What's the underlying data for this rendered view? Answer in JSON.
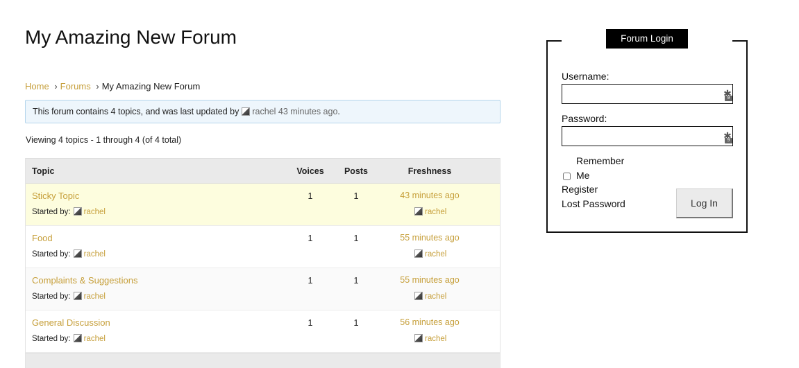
{
  "forum": {
    "title": "My Amazing New Forum",
    "breadcrumb": {
      "home": "Home",
      "forums": "Forums",
      "current": "My Amazing New Forum",
      "separator": "›"
    },
    "notice": {
      "text": "This forum contains 4 topics, and was last updated by",
      "user": "rachel",
      "ago": "43 minutes ago",
      "end": "."
    },
    "count_text": "Viewing 4 topics - 1 through 4 (of 4 total)",
    "columns": {
      "topic": "Topic",
      "voices": "Voices",
      "posts": "Posts",
      "freshness": "Freshness"
    },
    "started_label": "Started by:",
    "topics": [
      {
        "title": "Sticky Topic",
        "author": "rachel",
        "voices": "1",
        "posts": "1",
        "freshness": "43 minutes ago",
        "last_user": "rachel"
      },
      {
        "title": "Food",
        "author": "rachel",
        "voices": "1",
        "posts": "1",
        "freshness": "55 minutes ago",
        "last_user": "rachel"
      },
      {
        "title": "Complaints & Suggestions",
        "author": "rachel",
        "voices": "1",
        "posts": "1",
        "freshness": "55 minutes ago",
        "last_user": "rachel"
      },
      {
        "title": "General Discussion",
        "author": "rachel",
        "voices": "1",
        "posts": "1",
        "freshness": "56 minutes ago",
        "last_user": "rachel"
      }
    ]
  },
  "login": {
    "title": "Forum Login",
    "username_label": "Username:",
    "username_value": "",
    "password_label": "Password:",
    "password_value": "",
    "remember_line1": "Remember",
    "remember_line2": "Me",
    "register": "Register",
    "lost_password": "Lost Password",
    "button": "Log In",
    "pm_icon_badge": "9"
  },
  "colors": {
    "link": "#c69f3a",
    "sticky_bg": "#fdfdde",
    "notice_bg": "#eef6fc",
    "notice_border": "#b4d5ec",
    "header_bg": "#eaeaea"
  },
  "icons": {
    "avatar": "avatar-icon",
    "password_manager": "password-manager-icon"
  }
}
